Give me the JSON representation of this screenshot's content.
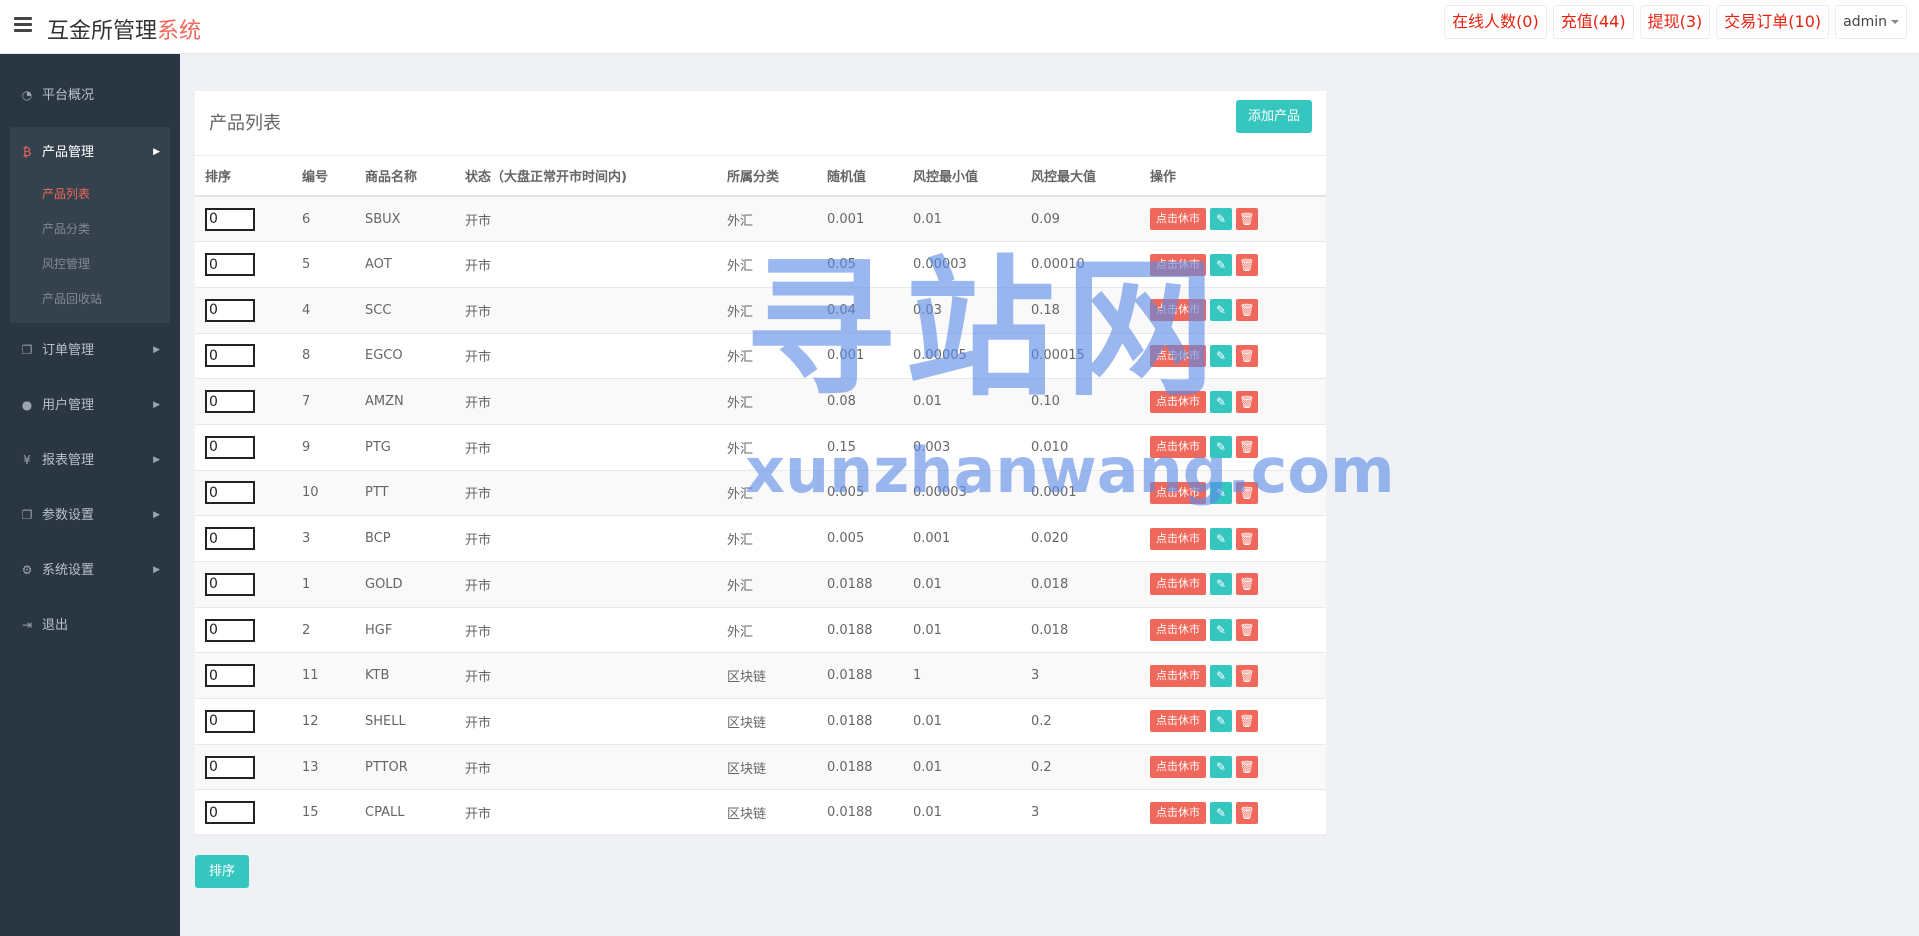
{
  "header": {
    "brand_main": "互金所管理",
    "brand_accent": "系统",
    "actions": [
      "在线人数(0)",
      "充值(44)",
      "提现(3)",
      "交易订单(10)"
    ],
    "user": "admin"
  },
  "sidebar": {
    "items": [
      {
        "label": "平台概况",
        "icon": "dashboard-icon"
      },
      {
        "label": "产品管理",
        "icon": "bitcoin-icon"
      },
      {
        "label": "订单管理",
        "icon": "copy-icon"
      },
      {
        "label": "用户管理",
        "icon": "user-icon"
      },
      {
        "label": "报表管理",
        "icon": "yen-icon"
      },
      {
        "label": "参数设置",
        "icon": "copy-icon"
      },
      {
        "label": "系统设置",
        "icon": "cogs-icon"
      },
      {
        "label": "退出",
        "icon": "sign-out-icon"
      }
    ],
    "sub_items": [
      "产品列表",
      "产品分类",
      "风控管理",
      "产品回收站"
    ]
  },
  "panel": {
    "title": "产品列表",
    "add_button": "添加产品"
  },
  "table": {
    "headers": [
      "排序",
      "编号",
      "商品名称",
      "状态（大盘正常开市时间内)",
      "所属分类",
      "随机值",
      "风控最小值",
      "风控最大值",
      "操作"
    ],
    "rest_label": "点击休市",
    "rows": [
      {
        "sort": "0",
        "id": "6",
        "name": "SBUX",
        "status": "开市",
        "category": "外汇",
        "random": "0.001",
        "min": "0.01",
        "max": "0.09"
      },
      {
        "sort": "0",
        "id": "5",
        "name": "AOT",
        "status": "开市",
        "category": "外汇",
        "random": "0.05",
        "min": "0.00003",
        "max": "0.00010"
      },
      {
        "sort": "0",
        "id": "4",
        "name": "SCC",
        "status": "开市",
        "category": "外汇",
        "random": "0.04",
        "min": "0.03",
        "max": "0.18"
      },
      {
        "sort": "0",
        "id": "8",
        "name": "EGCO",
        "status": "开市",
        "category": "外汇",
        "random": "0.001",
        "min": "0.00005",
        "max": "0.00015"
      },
      {
        "sort": "0",
        "id": "7",
        "name": "AMZN",
        "status": "开市",
        "category": "外汇",
        "random": "0.08",
        "min": "0.01",
        "max": "0.10"
      },
      {
        "sort": "0",
        "id": "9",
        "name": "PTG",
        "status": "开市",
        "category": "外汇",
        "random": "0.15",
        "min": "0.003",
        "max": "0.010"
      },
      {
        "sort": "0",
        "id": "10",
        "name": "PTT",
        "status": "开市",
        "category": "外汇",
        "random": "0.005",
        "min": "0.00003",
        "max": "0.0001"
      },
      {
        "sort": "0",
        "id": "3",
        "name": "BCP",
        "status": "开市",
        "category": "外汇",
        "random": "0.005",
        "min": "0.001",
        "max": "0.020"
      },
      {
        "sort": "0",
        "id": "1",
        "name": "GOLD",
        "status": "开市",
        "category": "外汇",
        "random": "0.0188",
        "min": "0.01",
        "max": "0.018"
      },
      {
        "sort": "0",
        "id": "2",
        "name": "HGF",
        "status": "开市",
        "category": "外汇",
        "random": "0.0188",
        "min": "0.01",
        "max": "0.018"
      },
      {
        "sort": "0",
        "id": "11",
        "name": "KTB",
        "status": "开市",
        "category": "区块链",
        "random": "0.0188",
        "min": "1",
        "max": "3"
      },
      {
        "sort": "0",
        "id": "12",
        "name": "SHELL",
        "status": "开市",
        "category": "区块链",
        "random": "0.0188",
        "min": "0.01",
        "max": "0.2"
      },
      {
        "sort": "0",
        "id": "13",
        "name": "PTTOR",
        "status": "开市",
        "category": "区块链",
        "random": "0.0188",
        "min": "0.01",
        "max": "0.2"
      },
      {
        "sort": "0",
        "id": "15",
        "name": "CPALL",
        "status": "开市",
        "category": "区块链",
        "random": "0.0188",
        "min": "0.01",
        "max": "3"
      }
    ]
  },
  "sort_button": "排序",
  "watermark": {
    "big": "寻站网",
    "small": "xunzhanwang.com"
  },
  "colors": {
    "accent": "#f0685b",
    "teal": "#36c6c0",
    "sidebar": "#2b3643"
  }
}
